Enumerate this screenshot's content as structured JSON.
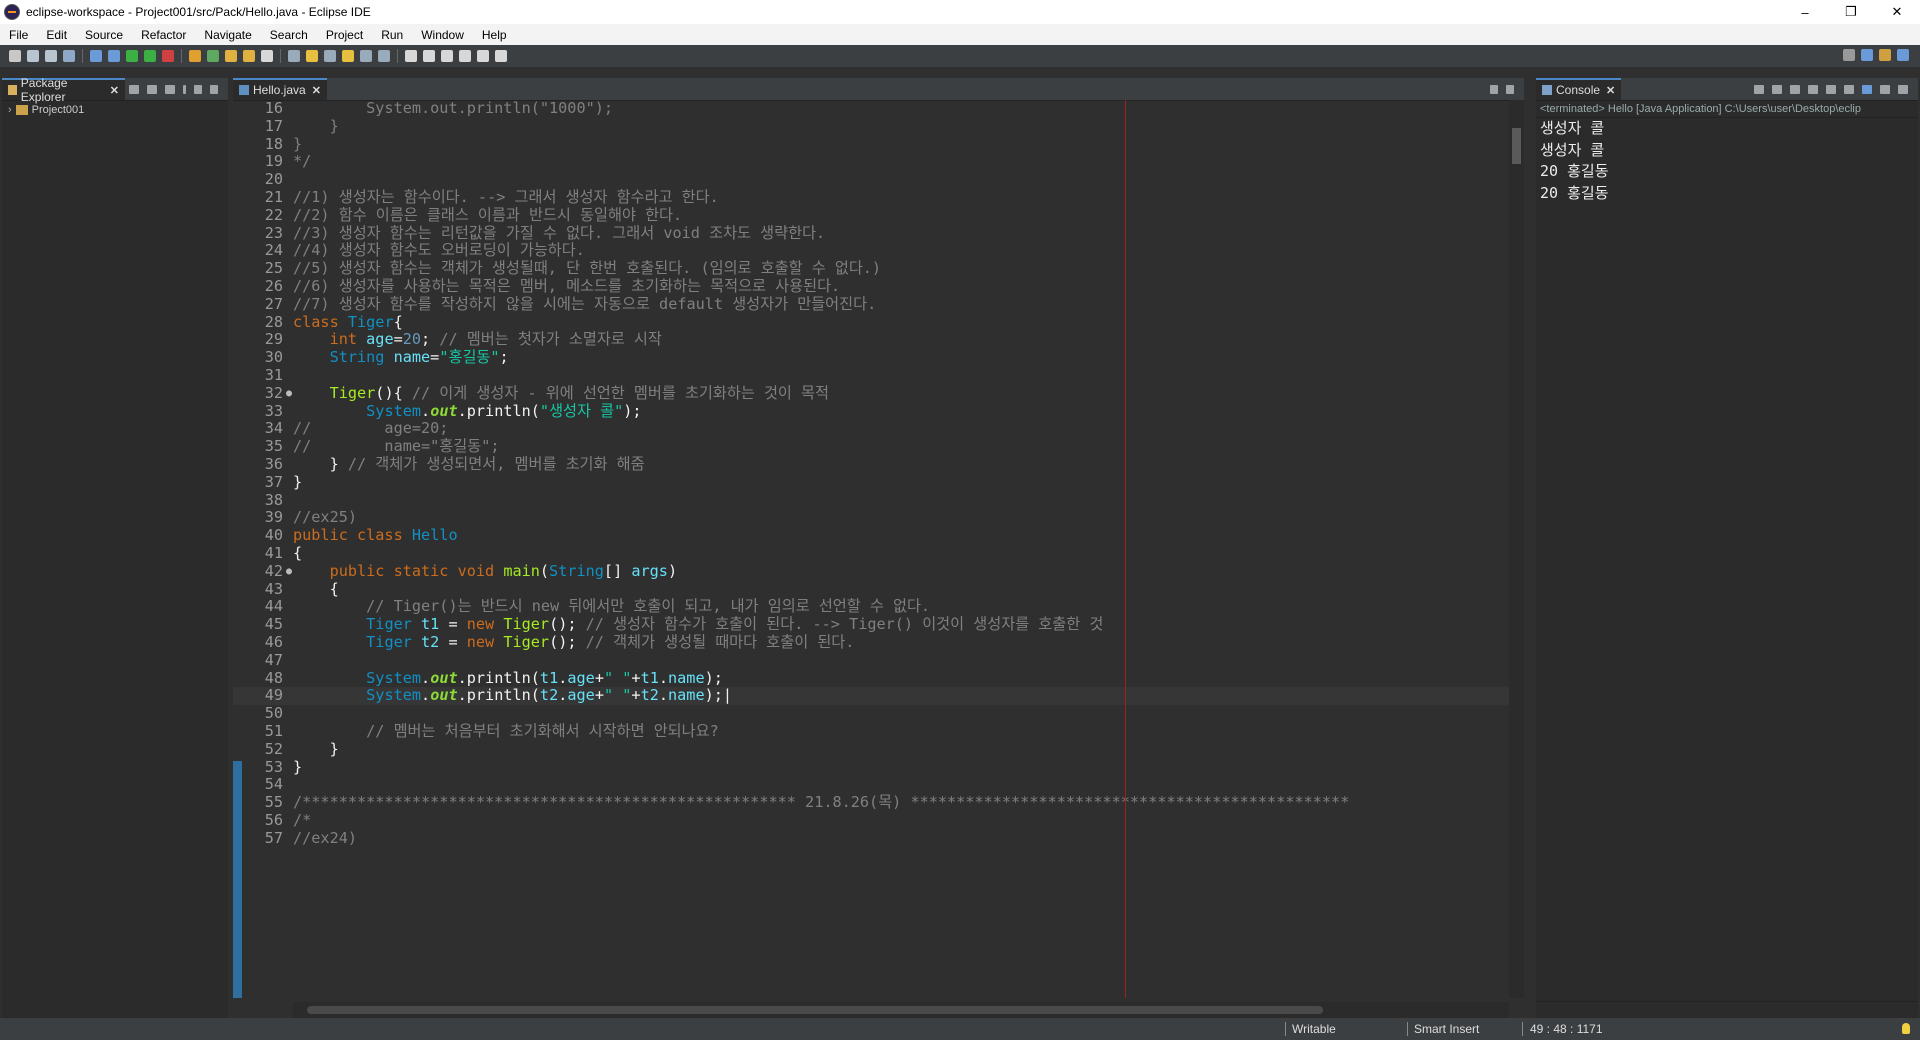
{
  "window": {
    "title": "eclipse-workspace - Project001/src/Pack/Hello.java - Eclipse IDE",
    "minimize": "–",
    "maximize": "❐",
    "close": "✕"
  },
  "menu": [
    "File",
    "Edit",
    "Source",
    "Refactor",
    "Navigate",
    "Search",
    "Project",
    "Run",
    "Window",
    "Help"
  ],
  "package_explorer": {
    "tab_label": "Package Explorer",
    "close": "✕",
    "project": "Project001",
    "expander": "›"
  },
  "editor": {
    "tab_label": "Hello.java",
    "close": "✕",
    "current_line": 49,
    "lines": [
      {
        "n": "16",
        "m": "",
        "t": [
          [
            "        System.out.println(\"1000\");",
            "cm"
          ]
        ]
      },
      {
        "n": "17",
        "m": "",
        "t": [
          [
            "    }",
            "cm"
          ]
        ]
      },
      {
        "n": "18",
        "m": "",
        "t": [
          [
            "}",
            "cm"
          ]
        ]
      },
      {
        "n": "19",
        "m": "",
        "t": [
          [
            "*/",
            "cm"
          ]
        ]
      },
      {
        "n": "20",
        "m": "",
        "t": []
      },
      {
        "n": "21",
        "m": "",
        "t": [
          [
            "//1) 생성자는 함수이다. --> 그래서 생성자 함수라고 한다.",
            "cm"
          ]
        ]
      },
      {
        "n": "22",
        "m": "",
        "t": [
          [
            "//2) 함수 이름은 클래스 이름과 반드시 동일해야 한다.",
            "cm"
          ]
        ]
      },
      {
        "n": "23",
        "m": "",
        "t": [
          [
            "//3) 생성자 함수는 리턴값을 가질 수 없다. 그래서 void 조차도 생략한다.",
            "cm"
          ]
        ]
      },
      {
        "n": "24",
        "m": "",
        "t": [
          [
            "//4) 생성자 함수도 오버로딩이 가능하다.",
            "cm"
          ]
        ]
      },
      {
        "n": "25",
        "m": "",
        "t": [
          [
            "//5) 생성자 함수는 객체가 생성될때, 단 한번 호출된다. (임의로 호출할 수 없다.)",
            "cm"
          ]
        ]
      },
      {
        "n": "26",
        "m": "",
        "t": [
          [
            "//6) 생성자를 사용하는 목적은 멤버, 메소드를 초기화하는 목적으로 사용된다.",
            "cm"
          ]
        ]
      },
      {
        "n": "27",
        "m": "",
        "t": [
          [
            "//7) 생성자 함수를 작성하지 않을 시에는 자동으로 default 생성자가 만들어진다.",
            "cm"
          ]
        ]
      },
      {
        "n": "28",
        "m": "",
        "t": [
          [
            "class ",
            "kw"
          ],
          [
            "Tiger",
            "cls"
          ],
          [
            "{",
            "ident"
          ]
        ]
      },
      {
        "n": "29",
        "m": "",
        "t": [
          [
            "    ",
            "ident"
          ],
          [
            "int ",
            "kw"
          ],
          [
            "age",
            "var"
          ],
          [
            "=",
            "ident"
          ],
          [
            "20",
            "num"
          ],
          [
            "; ",
            "ident"
          ],
          [
            "// 멤버는 첫자가 소멸자로 시작",
            "cm"
          ]
        ]
      },
      {
        "n": "30",
        "m": "",
        "t": [
          [
            "    ",
            "ident"
          ],
          [
            "String ",
            "ty"
          ],
          [
            "name",
            "var"
          ],
          [
            "=",
            "ident"
          ],
          [
            "\"홍길동\"",
            "str"
          ],
          [
            ";",
            "ident"
          ]
        ]
      },
      {
        "n": "31",
        "m": "",
        "t": []
      },
      {
        "n": "32",
        "m": "●",
        "t": [
          [
            "    ",
            "ident"
          ],
          [
            "Tiger",
            "meth"
          ],
          [
            "(){ ",
            "ident"
          ],
          [
            "// 이게 생성자 - 위에 선언한 멤버를 초기화하는 것이 목적",
            "cm"
          ]
        ]
      },
      {
        "n": "33",
        "m": "",
        "t": [
          [
            "        ",
            "ident"
          ],
          [
            "System",
            "ty"
          ],
          [
            ".",
            "ident"
          ],
          [
            "out",
            "fld"
          ],
          [
            ".println(",
            "ident"
          ],
          [
            "\"생성자 콜\"",
            "str"
          ],
          [
            ");",
            "ident"
          ]
        ]
      },
      {
        "n": "34",
        "m": "",
        "t": [
          [
            "//        age=20;",
            "cm"
          ]
        ]
      },
      {
        "n": "35",
        "m": "",
        "t": [
          [
            "//        name=\"홍길동\";",
            "cm"
          ]
        ]
      },
      {
        "n": "36",
        "m": "",
        "t": [
          [
            "    } ",
            "ident"
          ],
          [
            "// 객체가 생성되면서, 멤버를 초기화 해줌",
            "cm"
          ]
        ]
      },
      {
        "n": "37",
        "m": "",
        "t": [
          [
            "}",
            "ident"
          ]
        ]
      },
      {
        "n": "38",
        "m": "",
        "t": []
      },
      {
        "n": "39",
        "m": "",
        "t": [
          [
            "//ex25)",
            "cm"
          ]
        ]
      },
      {
        "n": "40",
        "m": "",
        "t": [
          [
            "public class ",
            "kw"
          ],
          [
            "Hello",
            "cls"
          ]
        ]
      },
      {
        "n": "41",
        "m": "",
        "t": [
          [
            "{",
            "ident"
          ]
        ]
      },
      {
        "n": "42",
        "m": "●",
        "t": [
          [
            "    ",
            "ident"
          ],
          [
            "public static void ",
            "kw"
          ],
          [
            "main",
            "meth"
          ],
          [
            "(",
            "ident"
          ],
          [
            "String",
            "ty"
          ],
          [
            "[] ",
            "ident"
          ],
          [
            "args",
            "var"
          ],
          [
            ")",
            "ident"
          ]
        ]
      },
      {
        "n": "43",
        "m": "",
        "t": [
          [
            "    {",
            "ident"
          ]
        ]
      },
      {
        "n": "44",
        "m": "",
        "t": [
          [
            "        // Tiger()는 반드시 new 뒤에서만 호출이 되고, 내가 임의로 선언할 수 없다.",
            "cm"
          ]
        ]
      },
      {
        "n": "45",
        "m": "",
        "t": [
          [
            "        ",
            "ident"
          ],
          [
            "Tiger ",
            "ty"
          ],
          [
            "t1",
            "var"
          ],
          [
            " = ",
            "ident"
          ],
          [
            "new ",
            "kw"
          ],
          [
            "Tiger",
            "meth"
          ],
          [
            "(); ",
            "ident"
          ],
          [
            "// 생성자 함수가 호출이 된다. --> Tiger() 이것이 생성자를 호출한 것",
            "cm"
          ]
        ]
      },
      {
        "n": "46",
        "m": "",
        "t": [
          [
            "        ",
            "ident"
          ],
          [
            "Tiger ",
            "ty"
          ],
          [
            "t2",
            "var"
          ],
          [
            " = ",
            "ident"
          ],
          [
            "new ",
            "kw"
          ],
          [
            "Tiger",
            "meth"
          ],
          [
            "(); ",
            "ident"
          ],
          [
            "// 객체가 생성될 때마다 호출이 된다.",
            "cm"
          ]
        ]
      },
      {
        "n": "47",
        "m": "",
        "t": []
      },
      {
        "n": "48",
        "m": "",
        "t": [
          [
            "        ",
            "ident"
          ],
          [
            "System",
            "ty"
          ],
          [
            ".",
            "ident"
          ],
          [
            "out",
            "fld"
          ],
          [
            ".println(",
            "ident"
          ],
          [
            "t1",
            "var"
          ],
          [
            ".",
            "ident"
          ],
          [
            "age",
            "fld2"
          ],
          [
            "+",
            "ident"
          ],
          [
            "\" \"",
            "str"
          ],
          [
            "+",
            "ident"
          ],
          [
            "t1",
            "var"
          ],
          [
            ".",
            "ident"
          ],
          [
            "name",
            "fld2"
          ],
          [
            ");",
            "ident"
          ]
        ]
      },
      {
        "n": "49",
        "m": "",
        "t": [
          [
            "        ",
            "ident"
          ],
          [
            "System",
            "ty"
          ],
          [
            ".",
            "ident"
          ],
          [
            "out",
            "fld"
          ],
          [
            ".println(",
            "ident"
          ],
          [
            "t2",
            "var"
          ],
          [
            ".",
            "ident"
          ],
          [
            "age",
            "fld2"
          ],
          [
            "+",
            "ident"
          ],
          [
            "\" \"",
            "str"
          ],
          [
            "+",
            "ident"
          ],
          [
            "t2",
            "var"
          ],
          [
            ".",
            "ident"
          ],
          [
            "name",
            "fld2"
          ],
          [
            ");",
            "ident"
          ],
          [
            "|",
            "ident"
          ]
        ]
      },
      {
        "n": "50",
        "m": "",
        "t": []
      },
      {
        "n": "51",
        "m": "",
        "t": [
          [
            "        // 멤버는 처음부터 초기화해서 시작하면 안되나요?",
            "cm"
          ]
        ]
      },
      {
        "n": "52",
        "m": "",
        "t": [
          [
            "    }",
            "ident"
          ]
        ]
      },
      {
        "n": "53",
        "m": "",
        "t": [
          [
            "}",
            "ident"
          ]
        ]
      },
      {
        "n": "54",
        "m": "",
        "t": []
      },
      {
        "n": "55",
        "m": "",
        "t": [
          [
            "/****************************************************** 21.8.26(목) ************************************************",
            "cm"
          ]
        ]
      },
      {
        "n": "56",
        "m": "",
        "t": [
          [
            "/*",
            "cm"
          ]
        ]
      },
      {
        "n": "57",
        "m": "",
        "t": [
          [
            "//ex24)",
            "cm"
          ]
        ]
      }
    ]
  },
  "console": {
    "tab_label": "Console",
    "close": "✕",
    "status": "<terminated> Hello [Java Application] C:\\Users\\user\\Desktop\\eclip",
    "output": [
      "생성자 콜",
      "생성자 콜",
      "20 홍길동",
      "20 홍길동"
    ]
  },
  "statusbar": {
    "writable": "Writable",
    "insert_mode": "Smart Insert",
    "position": "49 : 48 : 1171"
  },
  "colors": {
    "keyword": "#cc6c1d",
    "comment": "#808080",
    "string": "#17c6a3",
    "type": "#1290c3",
    "method": "#a7ec21",
    "print_margin": "#a02020"
  }
}
